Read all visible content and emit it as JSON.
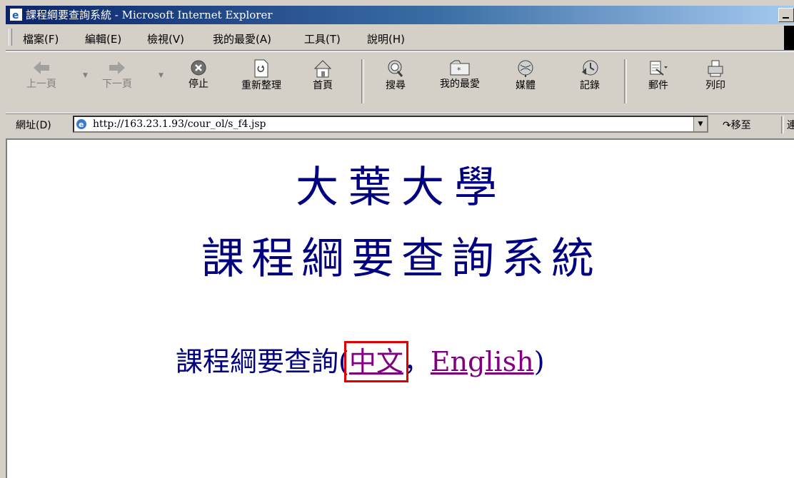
{
  "window": {
    "title": "課程綱要查詢系統 - Microsoft Internet Explorer"
  },
  "menu": {
    "items": [
      "檔案(F)",
      "編輯(E)",
      "檢視(V)",
      "我的最愛(A)",
      "工具(T)",
      "說明(H)"
    ]
  },
  "toolbar": {
    "back": "上一頁",
    "forward": "下一頁",
    "stop": "停止",
    "refresh": "重新整理",
    "home": "首頁",
    "search": "搜尋",
    "favorites": "我的最愛",
    "media": "媒體",
    "history": "記錄",
    "mail": "郵件",
    "print": "列印"
  },
  "address": {
    "label": "網址(D)",
    "url": "http://163.23.1.93/cour_ol/s_f4.jsp",
    "go": "移至",
    "links": "連"
  },
  "page": {
    "university": "大葉大學",
    "system_title": "課程綱要查詢系統",
    "query_prefix": "課程綱要查詢(",
    "link_chinese": "中文",
    "comma": "，",
    "link_english": "English",
    "query_suffix": ")"
  },
  "colors": {
    "heading": "#000080",
    "link": "#800080",
    "highlight": "#e00000"
  }
}
